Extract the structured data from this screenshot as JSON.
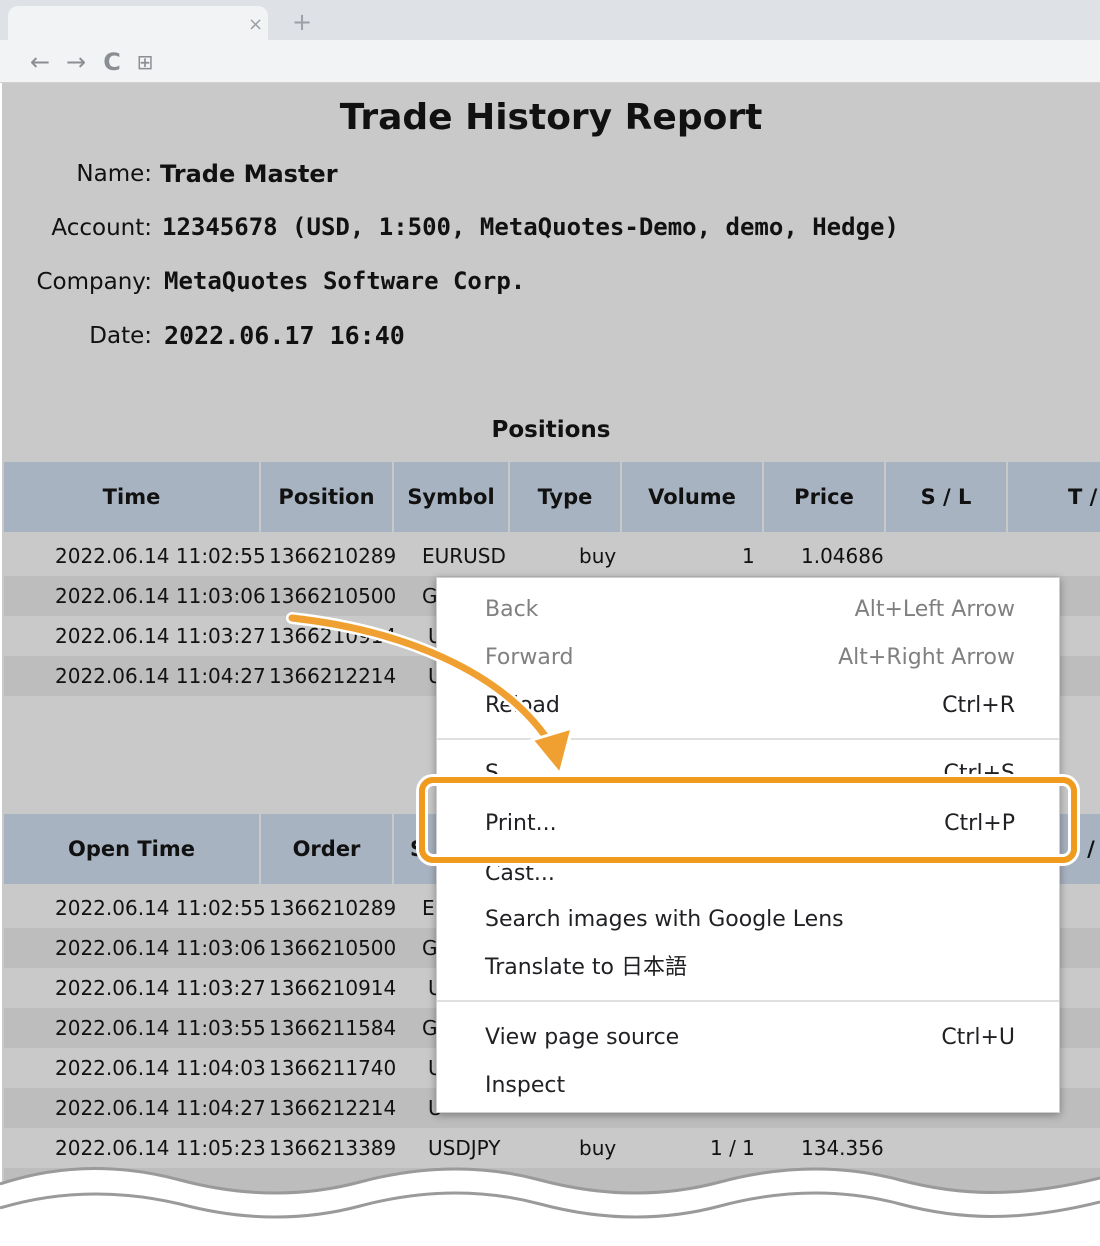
{
  "browser": {
    "tab_close": "×",
    "new_tab": "+",
    "nav": {
      "back": "←",
      "forward": "→",
      "reload": "C",
      "apps": "⊞"
    }
  },
  "report": {
    "title": "Trade History Report",
    "info": [
      {
        "label": "Name:",
        "value": "Trade Master"
      },
      {
        "label": "Account:",
        "value": "12345678 (USD, 1:500, MetaQuotes-Demo, demo, Hedge)"
      },
      {
        "label": "Company:",
        "value": "MetaQuotes Software Corp."
      },
      {
        "label": "Date:",
        "value": "2022.06.17 16:40"
      }
    ],
    "positions": {
      "title": "Positions",
      "headers": [
        "Time",
        "Position",
        "Symbol",
        "Type",
        "Volume",
        "Price",
        "S / L",
        "T /"
      ],
      "rows": [
        {
          "time": "2022.06.14 11:02:55",
          "id": "1366210289",
          "symbol": "EURUSD",
          "type": "buy",
          "volume": "1",
          "price": "1.04686"
        },
        {
          "time": "2022.06.14 11:03:06",
          "id": "1366210500",
          "symbol": "G",
          "type": "",
          "volume": "",
          "price": ""
        },
        {
          "time": "2022.06.14 11:03:27",
          "id": "1366210914",
          "symbol": "U",
          "type": "",
          "volume": "",
          "price": ""
        },
        {
          "time": "2022.06.14 11:04:27",
          "id": "1366212214",
          "symbol": "U",
          "type": "",
          "volume": "",
          "price": ""
        }
      ]
    },
    "orders": {
      "headers": [
        "Open Time",
        "Order",
        "S",
        "/"
      ],
      "rows": [
        {
          "time": "2022.06.14 11:02:55",
          "id": "1366210289",
          "symbol": "E",
          "type": "",
          "volume": "",
          "price": ""
        },
        {
          "time": "2022.06.14 11:03:06",
          "id": "1366210500",
          "symbol": "G",
          "type": "",
          "volume": "",
          "price": ""
        },
        {
          "time": "2022.06.14 11:03:27",
          "id": "1366210914",
          "symbol": "U",
          "type": "",
          "volume": "",
          "price": ""
        },
        {
          "time": "2022.06.14 11:03:55",
          "id": "1366211584",
          "symbol": "G",
          "type": "",
          "volume": "",
          "price": ""
        },
        {
          "time": "2022.06.14 11:04:03",
          "id": "1366211740",
          "symbol": "U",
          "type": "",
          "volume": "",
          "price": ""
        },
        {
          "time": "2022.06.14 11:04:27",
          "id": "1366212214",
          "symbol": "U",
          "type": "",
          "volume": "",
          "price": ""
        },
        {
          "time": "2022.06.14 11:05:23",
          "id": "1366213389",
          "symbol": "USDJPY",
          "type": "buy",
          "volume": "1 / 1",
          "price": "134.356"
        }
      ]
    }
  },
  "context_menu": {
    "items": [
      {
        "label": "Back",
        "shortcut": "Alt+Left Arrow",
        "disabled": true
      },
      {
        "label": "Forward",
        "shortcut": "Alt+Right Arrow",
        "disabled": true
      },
      {
        "label": "Reload",
        "shortcut": "Ctrl+R",
        "disabled": false
      },
      {
        "label": "S",
        "shortcut": "Ctrl+S",
        "disabled": false
      },
      {
        "label": "Print...",
        "shortcut": "Ctrl+P",
        "disabled": false
      },
      {
        "label": "Cast...",
        "shortcut": "",
        "disabled": false
      },
      {
        "label": "Search images with Google Lens",
        "shortcut": "",
        "disabled": false
      },
      {
        "label": "Translate to 日本語",
        "shortcut": "",
        "disabled": false
      },
      {
        "label": "View page source",
        "shortcut": "Ctrl+U",
        "disabled": false
      },
      {
        "label": "Inspect",
        "shortcut": "",
        "disabled": false
      }
    ]
  },
  "colors": {
    "highlight": "#f09a1e",
    "page_bg": "#c9c9c9",
    "header_bg": "#a8b3c1"
  }
}
